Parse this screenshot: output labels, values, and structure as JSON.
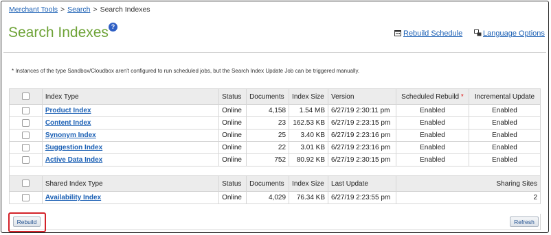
{
  "breadcrumb": {
    "items": [
      "Merchant Tools",
      "Search"
    ],
    "current": "Search Indexes",
    "separator": ">"
  },
  "header": {
    "title": "Search Indexes",
    "help_icon": "?",
    "rebuild_schedule_label": "Rebuild Schedule",
    "language_options_label": "Language Options"
  },
  "note": "* Instances of the type Sandbox/Cloudbox aren't configured to run scheduled jobs, but the Search Index Update Job can be triggered manually.",
  "index_table": {
    "columns": [
      "Index Type",
      "Status",
      "Documents",
      "Index Size",
      "Version",
      "Scheduled Rebuild",
      "Incremental Update"
    ],
    "required_marker": "*",
    "rows": [
      {
        "name": "Product Index",
        "status": "Online",
        "documents": "4,158",
        "size": "1.54 MB",
        "version": "6/27/19 2:30:11 pm",
        "scheduled": "Enabled",
        "incremental": "Enabled"
      },
      {
        "name": "Content Index",
        "status": "Online",
        "documents": "23",
        "size": "162.53 KB",
        "version": "6/27/19 2:23:15 pm",
        "scheduled": "Enabled",
        "incremental": "Enabled"
      },
      {
        "name": "Synonym Index",
        "status": "Online",
        "documents": "25",
        "size": "3.40 KB",
        "version": "6/27/19 2:23:16 pm",
        "scheduled": "Enabled",
        "incremental": "Enabled"
      },
      {
        "name": "Suggestion Index",
        "status": "Online",
        "documents": "22",
        "size": "3.01 KB",
        "version": "6/27/19 2:23:16 pm",
        "scheduled": "Enabled",
        "incremental": "Enabled"
      },
      {
        "name": "Active Data Index",
        "status": "Online",
        "documents": "752",
        "size": "80.92 KB",
        "version": "6/27/19 2:30:15 pm",
        "scheduled": "Enabled",
        "incremental": "Enabled"
      }
    ]
  },
  "shared_table": {
    "columns": [
      "Shared Index Type",
      "Status",
      "Documents",
      "Index Size",
      "Last Update",
      "Sharing Sites"
    ],
    "rows": [
      {
        "name": "Availability Index",
        "status": "Online",
        "documents": "4,029",
        "size": "76.34 KB",
        "last_update": "6/27/19 2:23:55 pm",
        "sharing_sites": "2"
      }
    ]
  },
  "buttons": {
    "rebuild": "Rebuild",
    "refresh": "Refresh"
  },
  "colors": {
    "title_green": "#6ea337",
    "link_blue": "#1a5fb4",
    "highlight_red": "#d32128"
  }
}
